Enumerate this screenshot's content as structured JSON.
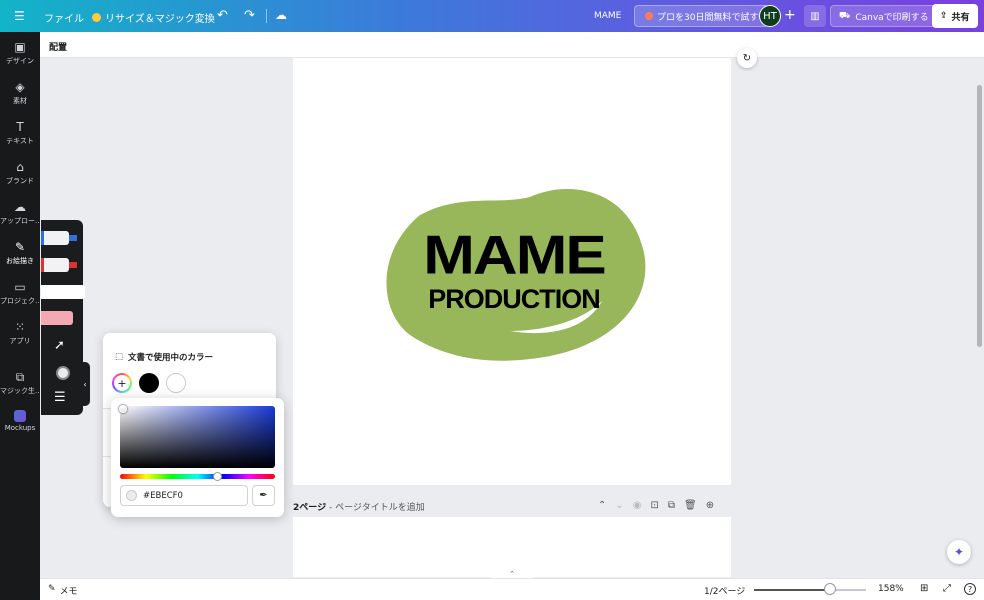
{
  "topbar": {
    "menu_icon": "menu-icon",
    "file_label": "ファイル",
    "resize_label": "リサイズ＆マジック変換",
    "doc_title": "MAME",
    "trial_label": "プロを30日間無料で試す",
    "avatar_initials": "HT",
    "print_label": "Canvaで印刷する",
    "share_label": "共有",
    "gradient_start": "#12b4c8",
    "gradient_end": "#7a3fe0"
  },
  "sidebar": {
    "items": [
      {
        "icon": "design-icon",
        "label": "デザイン"
      },
      {
        "icon": "elements-icon",
        "label": "素材"
      },
      {
        "icon": "text-icon",
        "label": "テキスト"
      },
      {
        "icon": "brand-icon",
        "label": "ブランド"
      },
      {
        "icon": "upload-icon",
        "label": "アップロー..."
      },
      {
        "icon": "draw-icon",
        "label": "お絵描き"
      },
      {
        "icon": "projects-icon",
        "label": "プロジェク..."
      },
      {
        "icon": "apps-icon",
        "label": "アプリ"
      },
      {
        "icon": "magic-media-icon",
        "label": "マジック生..."
      },
      {
        "icon": "mockups-icon",
        "label": "Mockups"
      }
    ]
  },
  "subbar": {
    "label": "配置"
  },
  "canvas": {
    "logo_line1": "MAME",
    "logo_line2": "PRODUCTION",
    "logo_green": "#97b75a",
    "page2_title_num": "2ページ",
    "page2_title_rest": " - ページタイトルを追加"
  },
  "color_panel": {
    "title": "文書で使用中のカラー",
    "colors": [
      "#000000",
      "#ffffff"
    ]
  },
  "picker": {
    "hex_value": "#EBECF0",
    "hue_color": "#1a3ad6"
  },
  "bottombar": {
    "notes_label": "メモ",
    "pages_label": "1/2ページ",
    "zoom_label": "158%",
    "zoom_fraction": 0.68
  }
}
